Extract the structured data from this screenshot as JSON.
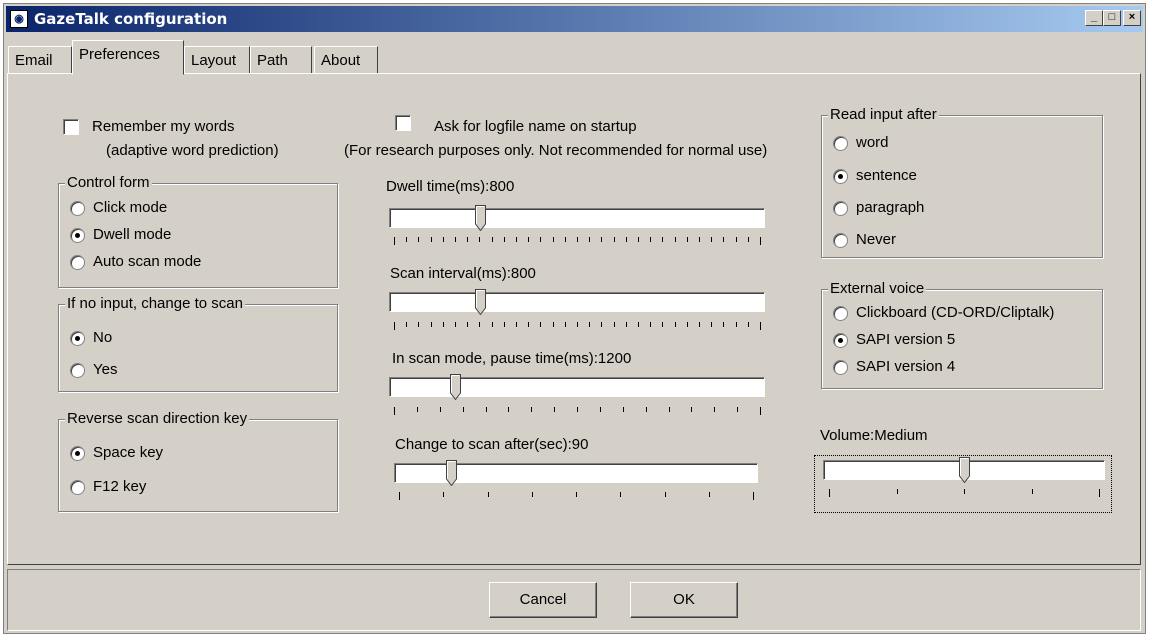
{
  "window": {
    "title": "GazeTalk configuration",
    "min_label": "_",
    "max_label": "□",
    "close_label": "×"
  },
  "tabs": [
    {
      "label": "Email",
      "active": false
    },
    {
      "label": "Preferences",
      "active": true
    },
    {
      "label": "Layout",
      "active": false
    },
    {
      "label": "Path",
      "active": false
    },
    {
      "label": "About",
      "active": false
    }
  ],
  "left": {
    "remember": {
      "line1": "Remember my words",
      "line2": "(adaptive word prediction)",
      "checked": false
    },
    "control_form": {
      "title": "Control form",
      "options": [
        "Click mode",
        "Dwell mode",
        "Auto scan mode"
      ],
      "selected": 1
    },
    "no_input": {
      "title": "If no input, change to scan",
      "options": [
        "No",
        "Yes"
      ],
      "selected": 0
    },
    "reverse_key": {
      "title": "Reverse scan direction key",
      "options": [
        "Space key",
        "F12 key"
      ],
      "selected": 0
    }
  },
  "middle": {
    "logfile": {
      "line1": "Ask for logfile name on startup",
      "line2": "(For research purposes only. Not recommended for normal use)",
      "checked": false
    },
    "sliders": [
      {
        "label": "Dwell time(ms):800",
        "fraction": 0.23,
        "ticks": 31,
        "major_every": 0
      },
      {
        "label": "Scan interval(ms):800",
        "fraction": 0.23,
        "ticks": 31,
        "major_every": 0
      },
      {
        "label": "In scan mode, pause time(ms):1200",
        "fraction": 0.16,
        "ticks": 17,
        "major_every": 0
      },
      {
        "label": "Change to scan after(sec):90",
        "fraction": 0.14,
        "ticks": 9,
        "major_every": 0
      }
    ]
  },
  "right": {
    "read_input": {
      "title": "Read input after",
      "options": [
        "word",
        "sentence",
        "paragraph",
        "Never"
      ],
      "selected": 1
    },
    "external_voice": {
      "title": "External voice",
      "options": [
        "Clickboard (CD-ORD/Cliptalk)",
        "SAPI version 5",
        "SAPI version 4"
      ],
      "selected": 1
    },
    "volume": {
      "label": "Volume:Medium",
      "fraction": 0.5,
      "ticks": 5
    }
  },
  "buttons": {
    "cancel": "Cancel",
    "ok": "OK"
  }
}
